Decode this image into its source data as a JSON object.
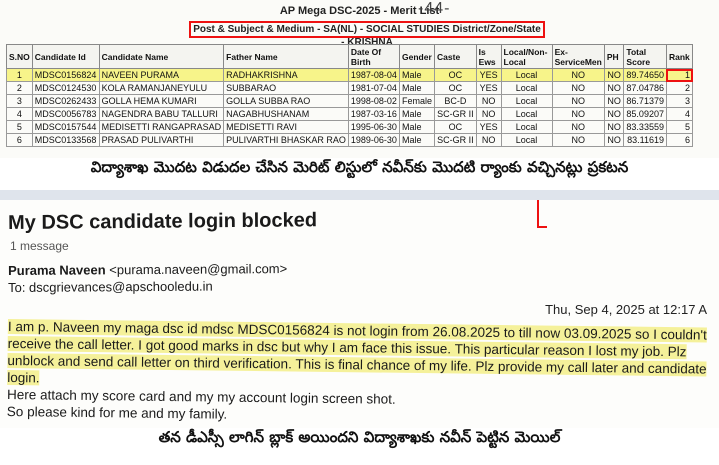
{
  "merit": {
    "title": "AP Mega DSC-2025 - Merit List",
    "page_no": "-44-",
    "subject_line": "Post & Subject & Medium - SA(NL) - SOCIAL STUDIES  District/Zone/State - KRISHNA",
    "columns": [
      "S.NO",
      "Candidate Id",
      "Candidate Name",
      "Father Name",
      "Date Of Birth",
      "Gender",
      "Caste",
      "Is Ews",
      "Local/Non-Local",
      "Ex-ServiceMen",
      "PH",
      "Total Score",
      "Rank"
    ],
    "rows": [
      {
        "sno": "1",
        "id": "MDSC0156824",
        "name": "NAVEEN PURAMA",
        "father": "RADHAKRISHNA",
        "dob": "1987-08-04",
        "gender": "Male",
        "caste": "OC",
        "ews": "YES",
        "local": "Local",
        "exs": "NO",
        "ph": "NO",
        "score": "89.74650",
        "rank": "1"
      },
      {
        "sno": "2",
        "id": "MDSC0124530",
        "name": "KOLA RAMANJANEYULU",
        "father": "SUBBARAO",
        "dob": "1981-07-04",
        "gender": "Male",
        "caste": "OC",
        "ews": "YES",
        "local": "Local",
        "exs": "NO",
        "ph": "NO",
        "score": "87.04786",
        "rank": "2"
      },
      {
        "sno": "3",
        "id": "MDSC0262433",
        "name": "GOLLA HEMA KUMARI",
        "father": "GOLLA SUBBA RAO",
        "dob": "1998-08-02",
        "gender": "Female",
        "caste": "BC-D",
        "ews": "NO",
        "local": "Local",
        "exs": "NO",
        "ph": "NO",
        "score": "86.71379",
        "rank": "3"
      },
      {
        "sno": "4",
        "id": "MDSC0056783",
        "name": "NAGENDRA BABU TALLURI",
        "father": "NAGABHUSHANAM",
        "dob": "1987-03-16",
        "gender": "Male",
        "caste": "SC-GR II",
        "ews": "NO",
        "local": "Local",
        "exs": "NO",
        "ph": "NO",
        "score": "85.09207",
        "rank": "4"
      },
      {
        "sno": "5",
        "id": "MDSC0157544",
        "name": "MEDISETTI RANGAPRASAD",
        "father": "MEDISETTI RAVI",
        "dob": "1995-06-30",
        "gender": "Male",
        "caste": "OC",
        "ews": "YES",
        "local": "Local",
        "exs": "NO",
        "ph": "NO",
        "score": "83.33559",
        "rank": "5"
      },
      {
        "sno": "6",
        "id": "MDSC0133568",
        "name": "PRASAD PULIVARTHI",
        "father": "PULIVARTHI BHASKAR RAO",
        "dob": "1989-06-30",
        "gender": "Male",
        "caste": "SC-GR II",
        "ews": "NO",
        "local": "Local",
        "exs": "NO",
        "ph": "NO",
        "score": "83.11619",
        "rank": "6"
      }
    ],
    "caption": "విద్యాశాఖ మొదట విడుదల చేసిన మెరిట్ లిస్టులో నవీన్‌కు మొదటి ర్యాంకు వచ్చినట్లు ప్రకటన"
  },
  "mail": {
    "subject": "My DSC candidate login blocked",
    "count": "1 message",
    "from_name": "Purama Naveen",
    "from_email": "<purama.naveen@gmail.com>",
    "to": "To: dscgrievances@apschooledu.in",
    "date": "Thu, Sep 4, 2025 at 12:17 A",
    "body_1": "I am p. Naveen my maga dsc id mdsc MDSC0156824 is not login from 26.08.2025 to till now 03.09.2025 so I couldn't receive the call letter. I got good marks in dsc but why I am face this issue. This particular reason I lost my job. Plz unblock and send call letter on third verification. This is final chance of my life. Plz provide my call later and candidate login.",
    "body_2": "Here attach my score card and my my account login screen shot.",
    "body_3": "So please kind for me and my family.",
    "caption": "తన డీఎస్సీ లాగిన్ బ్లాక్ అయిందని విద్యాశాఖకు నవీన్ పెట్టిన మెయిల్"
  }
}
